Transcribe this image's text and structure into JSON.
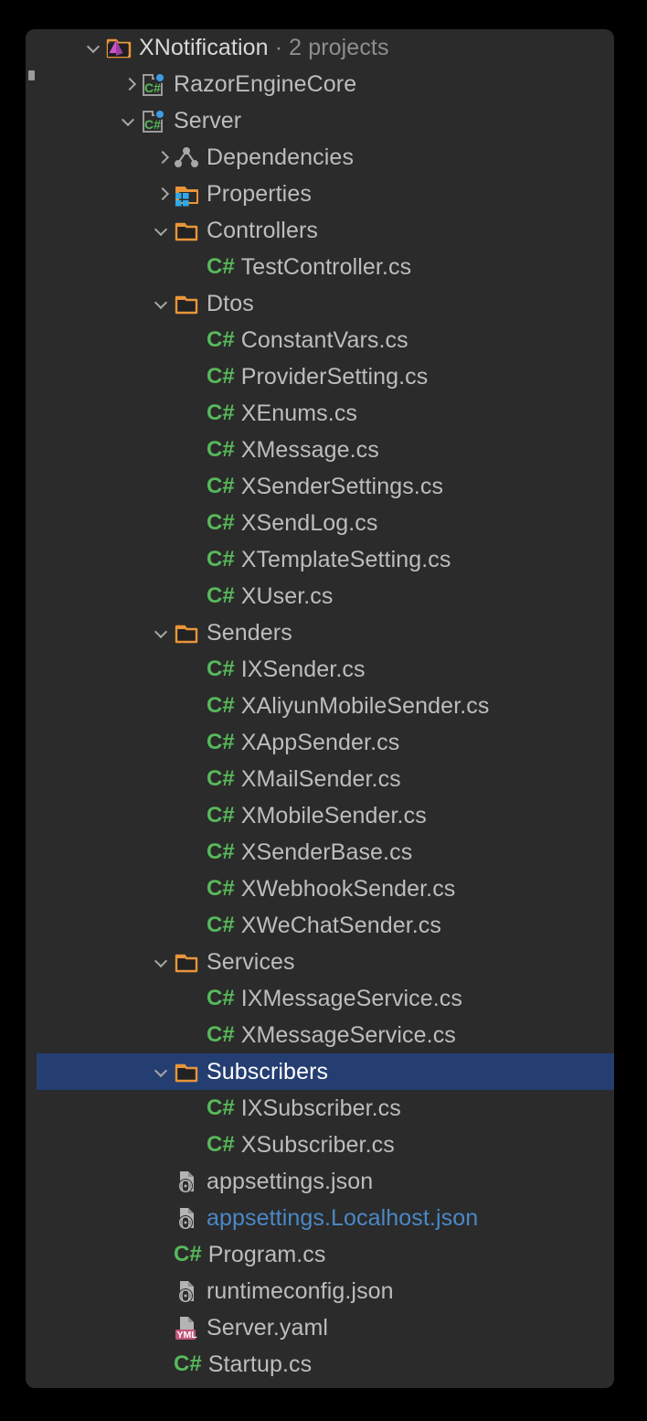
{
  "theme": {
    "panel_bg": "#2b2b2b",
    "selection_bg": "#253e72",
    "text": "#bdbdbd",
    "text_bright": "#d6d6d6",
    "text_dim": "#9a9a9a",
    "accent_blue_file": "#4a88c7",
    "csharp_green": "#57b95a",
    "folder_orange": "#e8953a",
    "yml_pink": "#c0557a",
    "solution_purple": "#cc55cc"
  },
  "solution": {
    "name": "XNotification",
    "separator": "·",
    "projects_count_label": "2 projects",
    "expanded": true,
    "icon": "solution-icon"
  },
  "tree": [
    {
      "id": "solution",
      "label": "XNotification",
      "suffix": "· 2 projects",
      "depth": 0,
      "twisty": "open",
      "icon": "solution-icon",
      "kind": "solution",
      "selected": false
    },
    {
      "id": "razorenginecore",
      "label": "RazorEngineCore",
      "depth": 1,
      "twisty": "closed",
      "icon": "csproj-icon",
      "kind": "project",
      "selected": false
    },
    {
      "id": "server",
      "label": "Server",
      "depth": 1,
      "twisty": "open",
      "icon": "csproj-icon",
      "kind": "project",
      "selected": false
    },
    {
      "id": "dependencies",
      "label": "Dependencies",
      "depth": 2,
      "twisty": "closed",
      "icon": "dependencies-icon",
      "kind": "node",
      "selected": false
    },
    {
      "id": "properties",
      "label": "Properties",
      "depth": 2,
      "twisty": "closed",
      "icon": "properties-folder-icon",
      "kind": "folder",
      "selected": false
    },
    {
      "id": "controllers",
      "label": "Controllers",
      "depth": 2,
      "twisty": "open",
      "icon": "folder-icon",
      "kind": "folder",
      "selected": false
    },
    {
      "id": "testcontroller",
      "label": "TestController.cs",
      "depth": 3,
      "twisty": "none",
      "icon": "csharp-icon",
      "kind": "cs-file",
      "selected": false
    },
    {
      "id": "dtos",
      "label": "Dtos",
      "depth": 2,
      "twisty": "open",
      "icon": "folder-icon",
      "kind": "folder",
      "selected": false
    },
    {
      "id": "constantvars",
      "label": "ConstantVars.cs",
      "depth": 3,
      "twisty": "none",
      "icon": "csharp-icon",
      "kind": "cs-file",
      "selected": false
    },
    {
      "id": "providersetting",
      "label": "ProviderSetting.cs",
      "depth": 3,
      "twisty": "none",
      "icon": "csharp-icon",
      "kind": "cs-file",
      "selected": false
    },
    {
      "id": "xenums",
      "label": "XEnums.cs",
      "depth": 3,
      "twisty": "none",
      "icon": "csharp-icon",
      "kind": "cs-file",
      "selected": false
    },
    {
      "id": "xmessage",
      "label": "XMessage.cs",
      "depth": 3,
      "twisty": "none",
      "icon": "csharp-icon",
      "kind": "cs-file",
      "selected": false
    },
    {
      "id": "xsendersettings",
      "label": "XSenderSettings.cs",
      "depth": 3,
      "twisty": "none",
      "icon": "csharp-icon",
      "kind": "cs-file",
      "selected": false
    },
    {
      "id": "xsendlog",
      "label": "XSendLog.cs",
      "depth": 3,
      "twisty": "none",
      "icon": "csharp-icon",
      "kind": "cs-file",
      "selected": false
    },
    {
      "id": "xtemplatesetting",
      "label": "XTemplateSetting.cs",
      "depth": 3,
      "twisty": "none",
      "icon": "csharp-icon",
      "kind": "cs-file",
      "selected": false
    },
    {
      "id": "xuser",
      "label": "XUser.cs",
      "depth": 3,
      "twisty": "none",
      "icon": "csharp-icon",
      "kind": "cs-file",
      "selected": false
    },
    {
      "id": "senders",
      "label": "Senders",
      "depth": 2,
      "twisty": "open",
      "icon": "folder-icon",
      "kind": "folder",
      "selected": false
    },
    {
      "id": "ixsender",
      "label": "IXSender.cs",
      "depth": 3,
      "twisty": "none",
      "icon": "csharp-icon",
      "kind": "cs-file",
      "selected": false
    },
    {
      "id": "xaliyunmobilesender",
      "label": "XAliyunMobileSender.cs",
      "depth": 3,
      "twisty": "none",
      "icon": "csharp-icon",
      "kind": "cs-file",
      "selected": false
    },
    {
      "id": "xappsender",
      "label": "XAppSender.cs",
      "depth": 3,
      "twisty": "none",
      "icon": "csharp-icon",
      "kind": "cs-file",
      "selected": false
    },
    {
      "id": "xmailsender",
      "label": "XMailSender.cs",
      "depth": 3,
      "twisty": "none",
      "icon": "csharp-icon",
      "kind": "cs-file",
      "selected": false
    },
    {
      "id": "xmobilesender",
      "label": "XMobileSender.cs",
      "depth": 3,
      "twisty": "none",
      "icon": "csharp-icon",
      "kind": "cs-file",
      "selected": false
    },
    {
      "id": "xsenderbase",
      "label": "XSenderBase.cs",
      "depth": 3,
      "twisty": "none",
      "icon": "csharp-icon",
      "kind": "cs-file",
      "selected": false
    },
    {
      "id": "xwebhooksender",
      "label": "XWebhookSender.cs",
      "depth": 3,
      "twisty": "none",
      "icon": "csharp-icon",
      "kind": "cs-file",
      "selected": false
    },
    {
      "id": "xwechatsender",
      "label": "XWeChatSender.cs",
      "depth": 3,
      "twisty": "none",
      "icon": "csharp-icon",
      "kind": "cs-file",
      "selected": false
    },
    {
      "id": "services",
      "label": "Services",
      "depth": 2,
      "twisty": "open",
      "icon": "folder-icon",
      "kind": "folder",
      "selected": false
    },
    {
      "id": "ixmessageservice",
      "label": "IXMessageService.cs",
      "depth": 3,
      "twisty": "none",
      "icon": "csharp-icon",
      "kind": "cs-file",
      "selected": false
    },
    {
      "id": "xmessageservice",
      "label": "XMessageService.cs",
      "depth": 3,
      "twisty": "none",
      "icon": "csharp-icon",
      "kind": "cs-file",
      "selected": false
    },
    {
      "id": "subscribers",
      "label": "Subscribers",
      "depth": 2,
      "twisty": "open",
      "icon": "folder-icon",
      "kind": "folder",
      "selected": true
    },
    {
      "id": "ixsubscriber",
      "label": "IXSubscriber.cs",
      "depth": 3,
      "twisty": "none",
      "icon": "csharp-icon",
      "kind": "cs-file",
      "selected": false
    },
    {
      "id": "xsubscriber",
      "label": "XSubscriber.cs",
      "depth": 3,
      "twisty": "none",
      "icon": "csharp-icon",
      "kind": "cs-file",
      "selected": false
    },
    {
      "id": "appsettings-json",
      "label": "appsettings.json",
      "depth": 2,
      "twisty": "none",
      "icon": "json-icon",
      "kind": "json-file",
      "selected": false
    },
    {
      "id": "appsettings-localhost",
      "label": "appsettings.Localhost.json",
      "depth": 2,
      "twisty": "none",
      "icon": "json-icon",
      "kind": "json-file-highlight",
      "selected": false
    },
    {
      "id": "program-cs",
      "label": "Program.cs",
      "depth": 2,
      "twisty": "none",
      "icon": "csharp-icon",
      "kind": "cs-file",
      "selected": false
    },
    {
      "id": "runtimeconfig-json",
      "label": "runtimeconfig.json",
      "depth": 2,
      "twisty": "none",
      "icon": "json-icon",
      "kind": "json-file",
      "selected": false
    },
    {
      "id": "server-yaml",
      "label": "Server.yaml",
      "depth": 2,
      "twisty": "none",
      "icon": "yaml-icon",
      "kind": "yaml-file",
      "selected": false
    },
    {
      "id": "startup-cs",
      "label": "Startup.cs",
      "depth": 2,
      "twisty": "none",
      "icon": "csharp-icon",
      "kind": "cs-file",
      "selected": false
    }
  ],
  "csharp_tag": "C#",
  "yml_tag": "YML",
  "scrollbar": {
    "name": "vertical-scrollbar-thumb"
  }
}
